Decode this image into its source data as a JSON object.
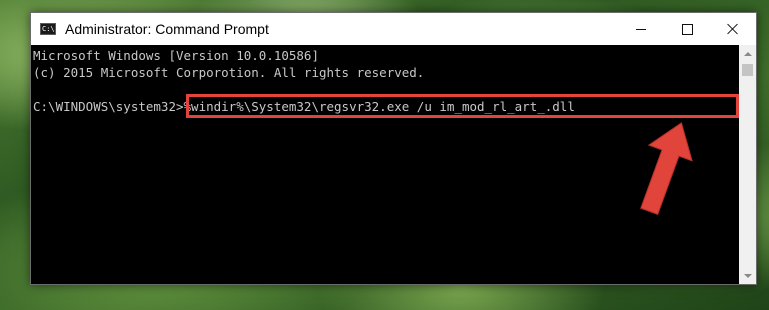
{
  "window": {
    "title": "Administrator: Command Prompt",
    "icon": "cmd-icon",
    "icon_text": "C:\\",
    "controls": {
      "minimize": "minimize-icon",
      "maximize": "maximize-icon",
      "close": "close-icon"
    }
  },
  "console": {
    "lines": [
      "Microsoft Windows [Version 10.0.10586]",
      "(c) 2015 Microsoft Corporotion. All rights reserved."
    ],
    "prompt": "C:\\WINDOWS\\system32>",
    "command": "%windir%\\System32\\regsvr32.exe /u im_mod_rl_art_.dll"
  },
  "annotation": {
    "highlight_color": "#e0443a",
    "arrow_color": "#e0443a"
  }
}
